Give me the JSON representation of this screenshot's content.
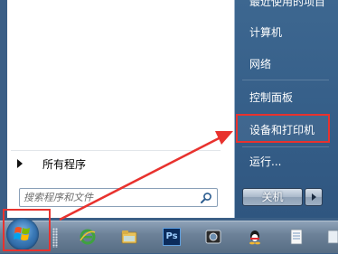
{
  "left_panel": {
    "all_programs_label": "所有程序",
    "search_placeholder": "搜索程序和文件"
  },
  "right_panel": {
    "items": [
      {
        "label": "最近使用的项目"
      },
      {
        "label": "计算机"
      },
      {
        "label": "网络"
      },
      {
        "label": "控制面板"
      },
      {
        "label": "设备和打印机"
      },
      {
        "label": "运行..."
      }
    ],
    "shutdown_label": "关机"
  },
  "taskbar": {
    "icons": [
      "start-orb-icon",
      "ie-icon",
      "file-explorer-icon",
      "photoshop-icon",
      "media-app-icon",
      "qq-icon",
      "notepad-icon",
      "file-icon"
    ],
    "photoshop_label": "Ps"
  },
  "colors": {
    "annotation_red": "#e8322e",
    "menu_blue": "#365f89"
  }
}
